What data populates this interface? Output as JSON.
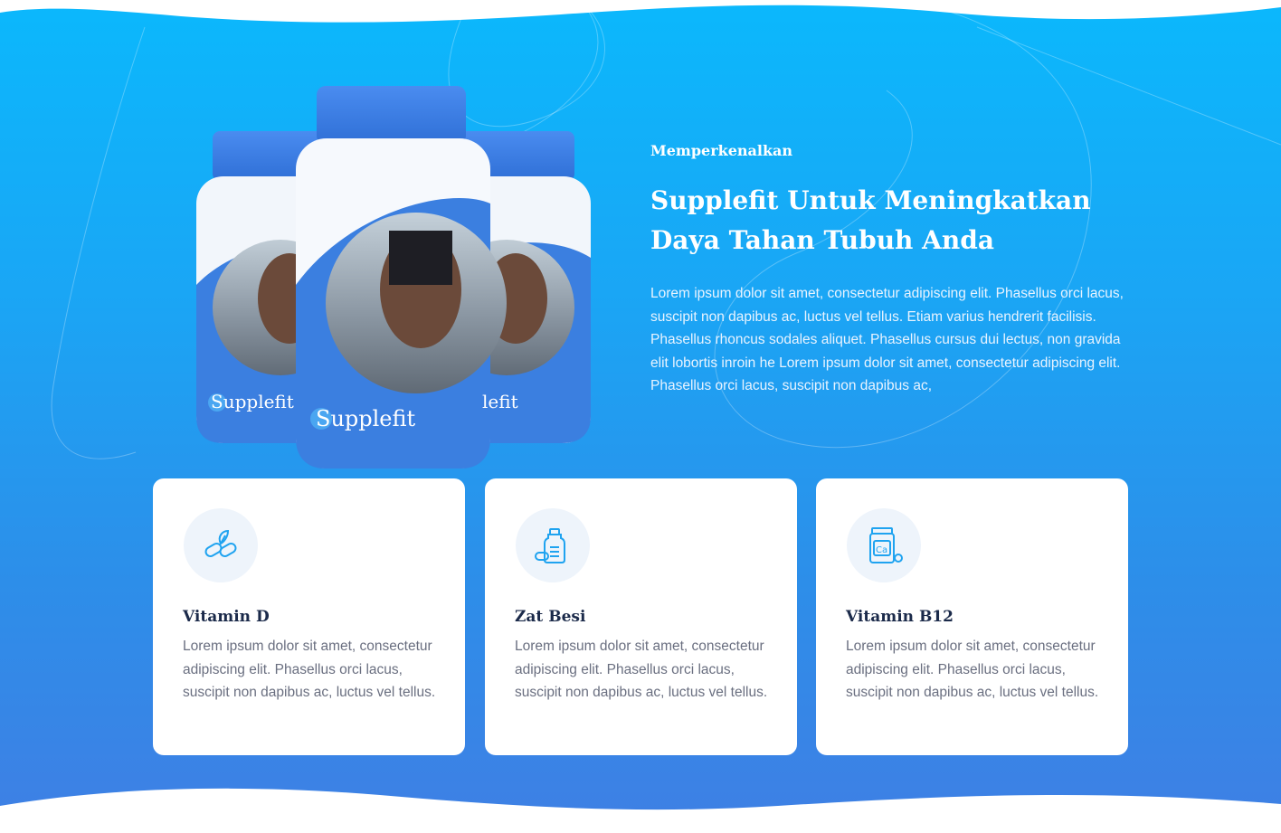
{
  "hero": {
    "eyebrow": "Memperkenalkan",
    "title": "Supplefit Untuk Meningkatkan Daya Tahan Tubuh Anda",
    "description": "Lorem ipsum dolor sit amet, consectetur adipiscing elit. Phasellus orci lacus, suscipit non dapibus ac, luctus vel tellus. Etiam varius hendrerit facilisis. Phasellus rhoncus sodales aliquet. Phasellus cursus dui lectus, non gravida elit lobortis inroin he Lorem ipsum dolor sit amet, consectetur adipiscing elit. Phasellus orci lacus, suscipit non dapibus ac,",
    "product_label_main": "Supplefit",
    "product_label_left": "Supplefit",
    "product_label_right": "lefit"
  },
  "features": [
    {
      "icon": "leaf-capsules-icon",
      "title": "Vitamin D",
      "text": "Lorem ipsum dolor sit amet, consectetur adipiscing elit. Phasellus orci lacus, suscipit non dapibus ac, luctus vel tellus."
    },
    {
      "icon": "medicine-bottle-icon",
      "title": "Zat Besi",
      "text": "Lorem ipsum dolor sit amet, consectetur adipiscing elit. Phasellus orci lacus, suscipit non dapibus ac, luctus vel tellus."
    },
    {
      "icon": "calcium-jar-icon",
      "title": "Vitamin B12",
      "text": "Lorem ipsum dolor sit amet, consectetur adipiscing elit. Phasellus orci lacus, suscipit non dapibus ac, luctus vel tellus."
    }
  ],
  "colors": {
    "gradient_top": "#0bb8fc",
    "gradient_bottom": "#3f7fe4",
    "bottle_blue": "#3b7fe0",
    "icon_blue": "#1fa3f0",
    "heading_dark": "#1b2a4a"
  }
}
